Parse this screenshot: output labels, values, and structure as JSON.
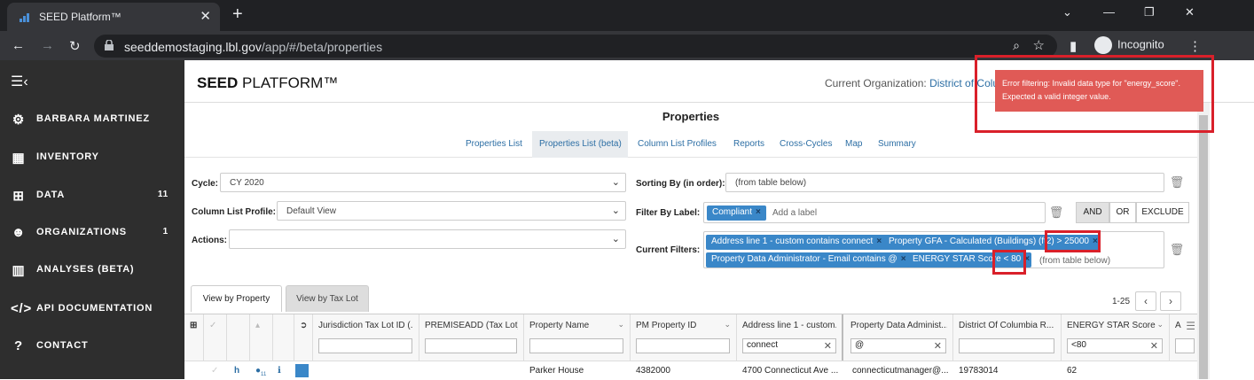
{
  "browser": {
    "tab_title": "SEED Platform™",
    "url_host": "seeddemostaging.lbl.gov",
    "url_path": "/app/#/beta/properties",
    "profile_label": "Incognito"
  },
  "sidebar": {
    "items": [
      {
        "label": "BARBARA MARTINEZ",
        "icon": "gear-icon",
        "count": ""
      },
      {
        "label": "INVENTORY",
        "icon": "building-icon",
        "count": ""
      },
      {
        "label": "DATA",
        "icon": "sitemap-icon",
        "count": "11"
      },
      {
        "label": "ORGANIZATIONS",
        "icon": "users-icon",
        "count": "1"
      },
      {
        "label": "ANALYSES (BETA)",
        "icon": "bar-chart-icon",
        "count": ""
      },
      {
        "label": "API DOCUMENTATION",
        "icon": "code-icon",
        "count": ""
      },
      {
        "label": "CONTACT",
        "icon": "question-icon",
        "count": ""
      }
    ]
  },
  "header": {
    "logo_bold": "SEED",
    "logo_rest": " PLATFORM™",
    "org_label": "Current Organization: ",
    "org_name": "District of Columbia"
  },
  "toast": {
    "message": "Error filtering: Invalid data type for \"energy_score\". Expected a valid integer value."
  },
  "page": {
    "title": "Properties",
    "subnav": [
      "Properties List",
      "Properties List (beta)",
      "Column List Profiles",
      "Reports",
      "Cross-Cycles",
      "Map",
      "Summary"
    ]
  },
  "filters": {
    "cycle_label": "Cycle:",
    "cycle_value": "CY 2020",
    "profile_label": "Column List Profile:",
    "profile_value": "Default View",
    "actions_label": "Actions:",
    "actions_value": "",
    "sorting_label": "Sorting By (in order):",
    "sorting_placeholder": "(from table below)",
    "label_filter_label": "Filter By Label:",
    "label_chip": "Compliant",
    "label_placeholder": "Add a label",
    "logic_and": "AND",
    "logic_or": "OR",
    "logic_exclude": "EXCLUDE",
    "current_filters_label": "Current Filters:",
    "chips": [
      "Address line 1 - custom contains connect",
      "Property GFA - Calculated (Buildings) (ft2)",
      "> 25000",
      "Property Data Administrator - Email contains @",
      "ENERGY STAR Score",
      "< 80"
    ],
    "current_placeholder": "(from table below)"
  },
  "view_tabs": {
    "property": "View by Property",
    "taxlot": "View by Tax Lot"
  },
  "pager": {
    "range": "1-25"
  },
  "grid": {
    "columns": [
      {
        "title": "Jurisdiction Tax Lot ID (...",
        "filter": ""
      },
      {
        "title": "PREMISEADD (Tax Lot) (...",
        "filter": ""
      },
      {
        "title": "Property Name",
        "filter": ""
      },
      {
        "title": "PM Property ID",
        "filter": ""
      },
      {
        "title": "Address line 1 - custom...",
        "filter": "connect"
      },
      {
        "title": "Property Data Administ...",
        "filter": "@"
      },
      {
        "title": "District Of Columbia R...",
        "filter": ""
      },
      {
        "title": "ENERGY STAR Score",
        "filter": "<80"
      },
      {
        "title": "A",
        "filter": ""
      }
    ],
    "row": {
      "note_count": "11",
      "cells": [
        "",
        "",
        "Parker House",
        "4382000",
        "4700 Connecticut Ave ...",
        "connecticutmanager@...",
        "19783014",
        "62",
        ""
      ]
    }
  }
}
